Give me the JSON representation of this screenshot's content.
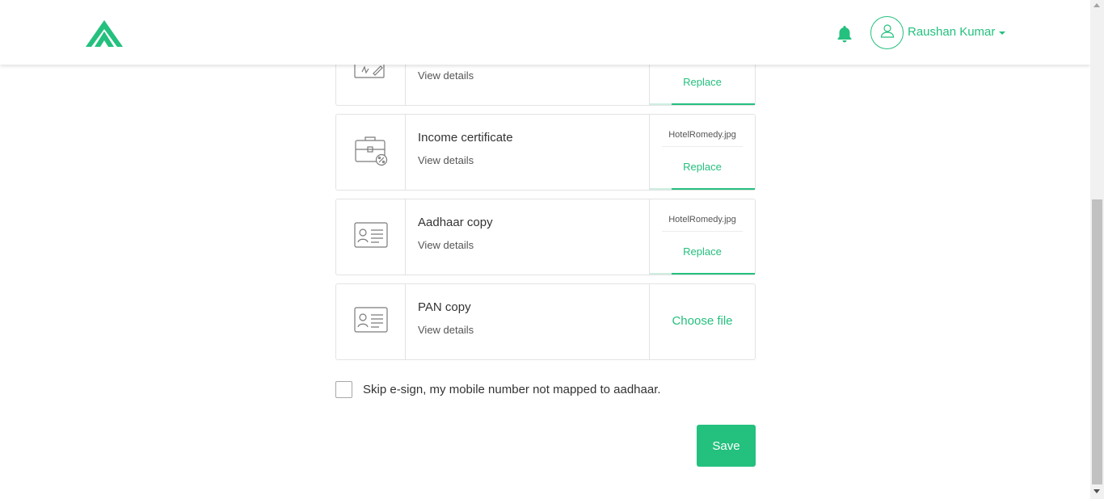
{
  "brand": {
    "accent": "#24c07e",
    "logo_icon": "mountain-logo-icon"
  },
  "header": {
    "notification_icon": "bell-icon",
    "user_icon": "user-icon",
    "user_name": "Raushan Kumar",
    "menu_icon": "caret-down-icon"
  },
  "documents": [
    {
      "title": "",
      "view_details": "View details",
      "file_name": "",
      "action": "Replace",
      "icon": "signature-icon"
    },
    {
      "title": "Income certificate",
      "view_details": "View details",
      "file_name": "HotelRomedy.jpg",
      "action": "Replace",
      "icon": "briefcase-percent-icon"
    },
    {
      "title": "Aadhaar copy",
      "view_details": "View details",
      "file_name": "HotelRomedy.jpg",
      "action": "Replace",
      "icon": "id-card-icon"
    },
    {
      "title": "PAN copy",
      "view_details": "View details",
      "action": "Choose file",
      "icon": "id-card-icon"
    }
  ],
  "skip_esign": {
    "label": "Skip e-sign, my mobile number not mapped to aadhaar.",
    "checked": false
  },
  "save_label": "Save"
}
